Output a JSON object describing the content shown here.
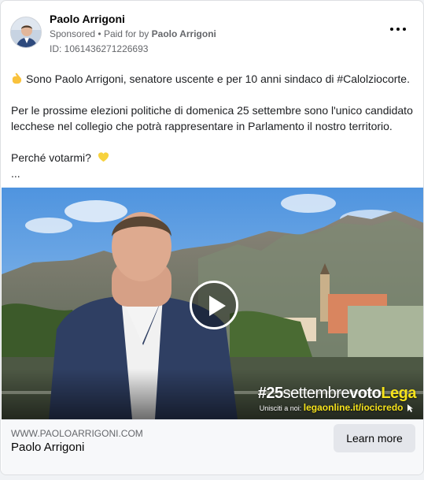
{
  "advertiser": {
    "name": "Paolo Arrigoni",
    "sponsored_label": "Sponsored",
    "paid_for_prefix": "Paid for by",
    "paid_for_name": "Paolo Arrigoni",
    "ad_id": "ID: 1061436271226693"
  },
  "post": {
    "line1": "Sono Paolo Arrigoni, senatore uscente e per 10 anni sindaco di #Calolziocorte.",
    "line2": "Per le prossime elezioni politiche di domenica 25 settembre sono l'unico candidato lecchese nel collegio che potrà rappresentare in Parlamento il nostro territorio.",
    "line3": "Perché votarmi?",
    "ellipsis": "..."
  },
  "video": {
    "hashtag_prefix": "#25",
    "hashtag_mid": "settembre",
    "hashtag_voto": "voto",
    "hashtag_lega": "Lega",
    "join_text": "Unisciti a noi:",
    "join_link": "legaonline.it/iocicredo"
  },
  "footer": {
    "domain": "WWW.PAOLOARRIGONI.COM",
    "title": "Paolo Arrigoni",
    "cta": "Learn more"
  },
  "icons": {
    "hand": "pointing-hand-icon",
    "heart": "yellow-heart-icon",
    "more": "more-options-icon",
    "play": "play-icon",
    "cursor": "click-cursor-icon"
  },
  "colors": {
    "tag_yellow": "#f5e21b",
    "cta_bg": "#e4e6eb"
  }
}
